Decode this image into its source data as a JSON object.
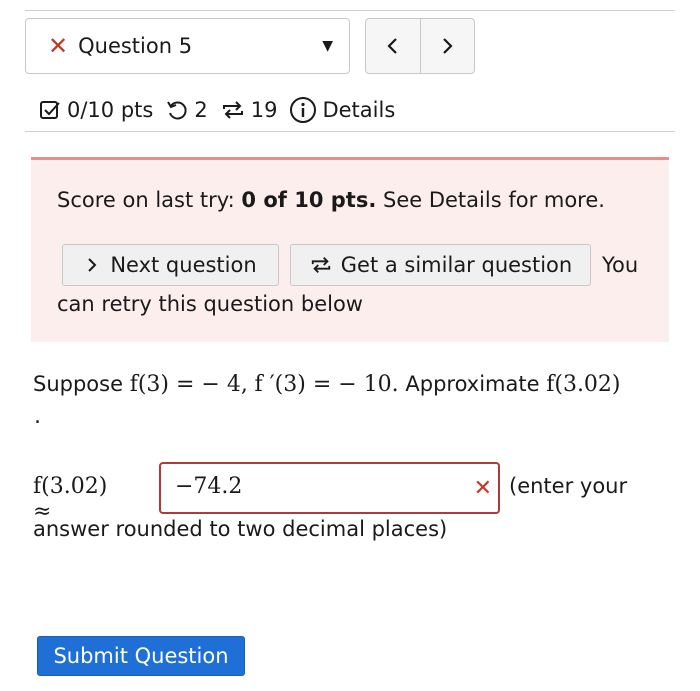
{
  "header": {
    "question_selector": {
      "status_icon": "close-icon",
      "label": "Question 5",
      "dropdown_icon": "caret-down-icon"
    },
    "nav": {
      "prev_icon": "chevron-left-icon",
      "next_icon": "chevron-right-icon"
    }
  },
  "meta": {
    "points": "0/10 pts",
    "retries": "2",
    "attempts": "19",
    "details": "Details"
  },
  "alert": {
    "score_prefix": "Score on last try:",
    "score_value": "0 of 10 pts.",
    "score_suffix": "See Details for more.",
    "next_button": "Next question",
    "similar_button": "Get a similar question",
    "retry_text_1": "You",
    "retry_text_2": "can retry this question below"
  },
  "question": {
    "prefix": "Suppose",
    "expr1": "f(3) = − 4,",
    "expr2": "f ′(3) = − 10.",
    "middle": "Approximate",
    "expr3": "f(3.02)",
    "trailing_dot": "."
  },
  "answer": {
    "label": "f(3.02) ≈",
    "value": "−74.2",
    "note_1": "(enter your",
    "note_2": "answer rounded to two decimal places)"
  },
  "submit_label": "Submit Question",
  "colors": {
    "accent": "#1f70d6",
    "error": "#c0392b",
    "alert_bg": "#fdeeee"
  }
}
